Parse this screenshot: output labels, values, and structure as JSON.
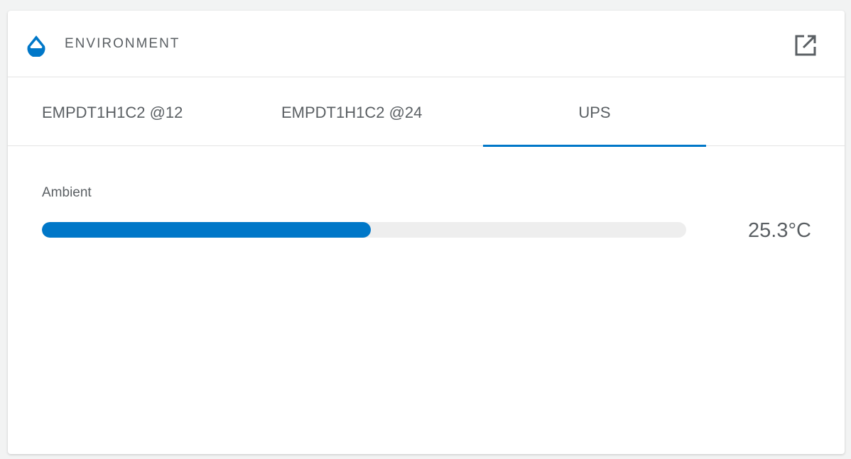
{
  "widget": {
    "title": "ENVIRONMENT",
    "icon": "water-drop-icon",
    "action_icon": "open-external-icon",
    "accent_color": "#0077c8"
  },
  "tabs": [
    {
      "label": "EMPDT1H1C2 @12",
      "active": false
    },
    {
      "label": "EMPDT1H1C2 @24",
      "active": false
    },
    {
      "label": "UPS",
      "active": true
    }
  ],
  "metrics": [
    {
      "label": "Ambient",
      "value": "25.3°C",
      "fill_fraction": 0.51
    }
  ]
}
